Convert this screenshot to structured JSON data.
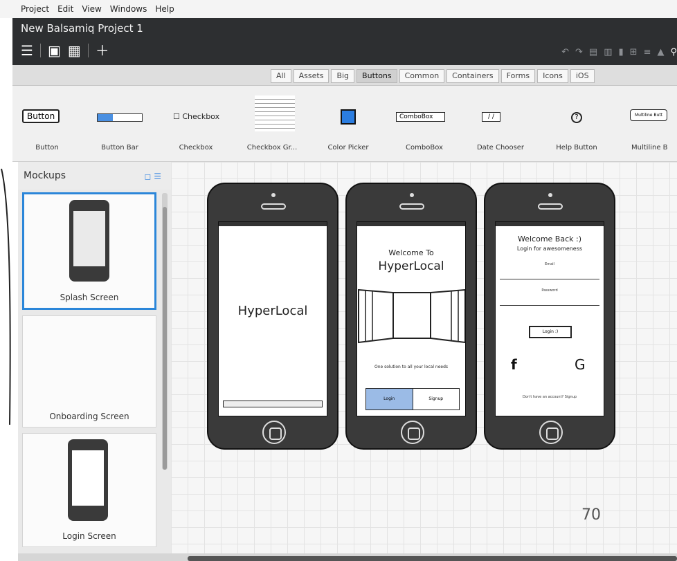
{
  "menu": [
    "Project",
    "Edit",
    "View",
    "Windows",
    "Help"
  ],
  "project_title": "New Balsamiq Project 1",
  "filters": [
    "All",
    "Assets",
    "Big",
    "Buttons",
    "Common",
    "Containers",
    "Forms",
    "Icons",
    "iOS"
  ],
  "active_filter": "Buttons",
  "components": [
    {
      "label": "Button",
      "preview": "Button"
    },
    {
      "label": "Button Bar",
      "preview": ""
    },
    {
      "label": "Checkbox",
      "preview": "Checkbox"
    },
    {
      "label": "Checkbox Gr...",
      "preview": ""
    },
    {
      "label": "Color Picker",
      "preview": ""
    },
    {
      "label": "ComboBox",
      "preview": "ComboBox"
    },
    {
      "label": "Date Chooser",
      "preview": "/ /"
    },
    {
      "label": "Help Button",
      "preview": ""
    },
    {
      "label": "Multiline B",
      "preview": "Multiline Butt"
    }
  ],
  "panel_title": "Mockups",
  "mockups": [
    "Splash Screen",
    "Onboarding Screen",
    "Login Screen"
  ],
  "phones": {
    "splash": {
      "title": "HyperLocal"
    },
    "onboarding": {
      "line1": "Welcome To",
      "line2": "HyperLocal",
      "tagline": "One solution to all your local needs",
      "btn1": "Login",
      "btn2": "Signup"
    },
    "login": {
      "line1": "Welcome Back :)",
      "line2": "Login for awesomeness",
      "email": "Email",
      "password": "Password",
      "button": "Login :)",
      "fb": "f",
      "g": "G",
      "footer": "Don't have an account? Signup"
    }
  },
  "page_number": "70",
  "colors": {
    "accent": "#2b86d9",
    "dark": "#2d2f31"
  }
}
